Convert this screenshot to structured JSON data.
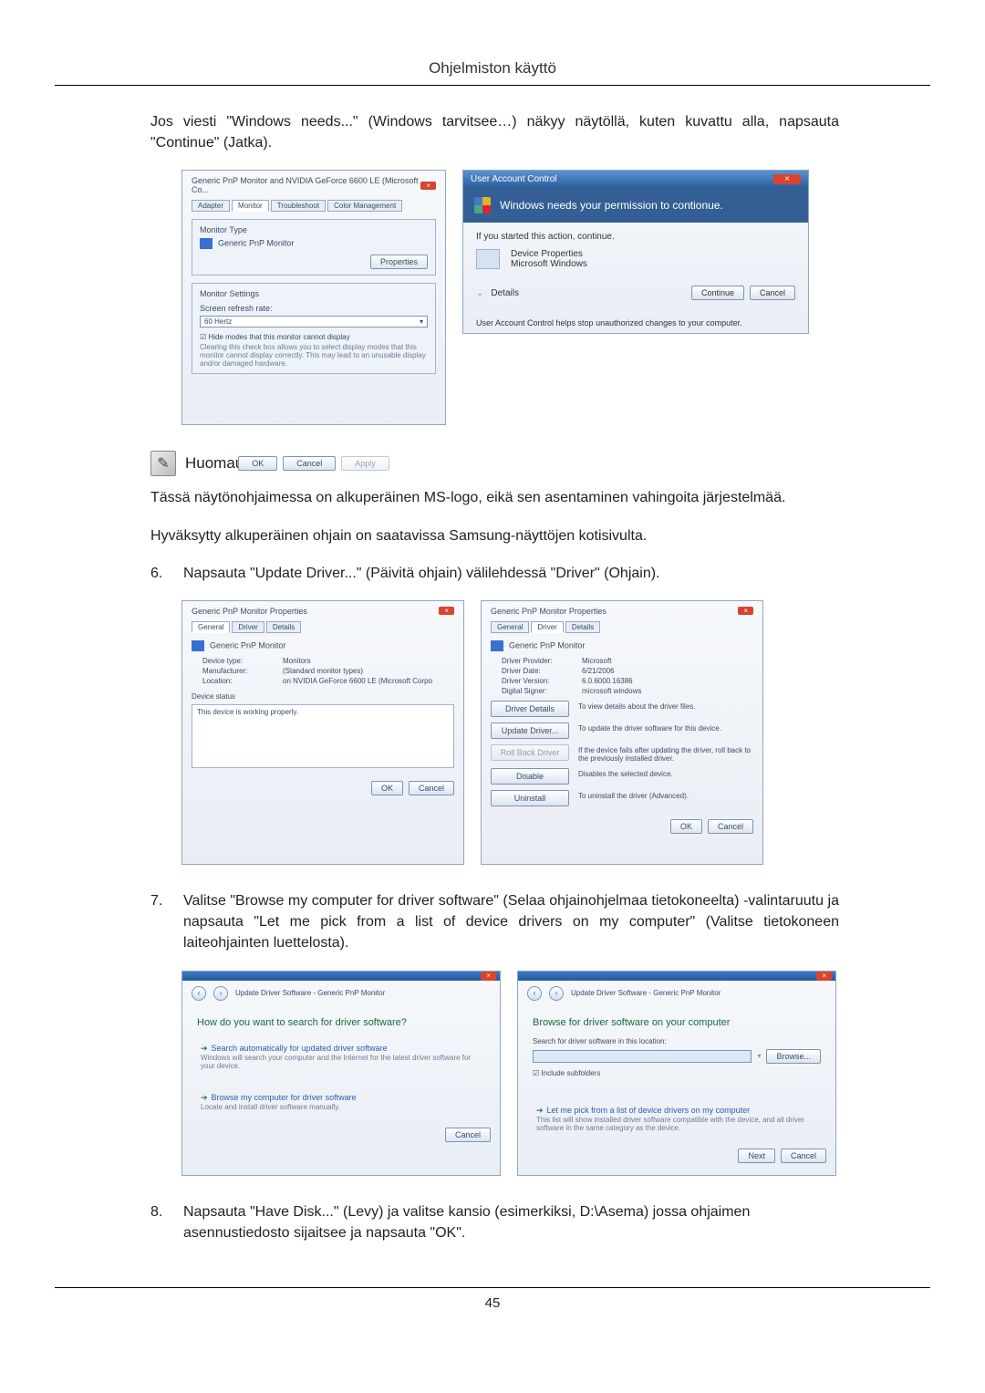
{
  "header": {
    "title": "Ohjelmiston käyttö"
  },
  "intro": "Jos viesti \"Windows needs...\" (Windows tarvitsee…) näkyy näytöllä, kuten kuvattu alla, napsauta \"Continue\" (Jatka).",
  "shot1": {
    "title": "Generic PnP Monitor and NVIDIA GeForce 6600 LE (Microsoft Co...",
    "tabs": {
      "adapter": "Adapter",
      "monitor": "Monitor",
      "troubleshoot": "Troubleshoot",
      "colormgmt": "Color Management"
    },
    "monitor_type_label": "Monitor Type",
    "monitor_name": "Generic PnP Monitor",
    "properties_btn": "Properties",
    "settings_label": "Monitor Settings",
    "refresh_label": "Screen refresh rate:",
    "refresh_value": "60 Hertz",
    "hide_modes": "Hide modes that this monitor cannot display",
    "hide_modes_desc": "Clearing this check box allows you to select display modes that this monitor cannot display correctly. This may lead to an unusable display and/or damaged hardware.",
    "ok": "OK",
    "cancel": "Cancel",
    "apply": "Apply"
  },
  "uac": {
    "title": "User Account Control",
    "banner": "Windows needs your permission to contionue.",
    "line1": "If you started this action, continue.",
    "prog": "Device Properties",
    "pub": "Microsoft Windows",
    "details": "Details",
    "continue": "Continue",
    "cancel": "Cancel",
    "foot": "User Account Control helps stop unauthorized changes to your computer."
  },
  "note": {
    "label": "Huomautus"
  },
  "note_p1": "Tässä näytönohjaimessa on alkuperäinen MS-logo, eikä sen asentaminen vahingoita järjestelmää.",
  "note_p2": "Hyväksytty alkuperäinen ohjain on saatavissa Samsung-näyttöjen kotisivulta.",
  "step6": {
    "num": "6.",
    "text": "Napsauta \"Update Driver...\" (Päivitä ohjain) välilehdessä \"Driver\" (Ohjain)."
  },
  "prop_general": {
    "title": "Generic PnP Monitor Properties",
    "tabs": {
      "general": "General",
      "driver": "Driver",
      "details": "Details"
    },
    "name": "Generic PnP Monitor",
    "devtype_k": "Device type:",
    "devtype_v": "Monitors",
    "manu_k": "Manufacturer:",
    "manu_v": "(Standard monitor types)",
    "loc_k": "Location:",
    "loc_v": "on NVIDIA GeForce 6600 LE (Microsoft Corpo",
    "status_label": "Device status",
    "status_text": "This device is working properly.",
    "ok": "OK",
    "cancel": "Cancel"
  },
  "prop_driver": {
    "title": "Generic PnP Monitor Properties",
    "name": "Generic PnP Monitor",
    "prov_k": "Driver Provider:",
    "prov_v": "Microsoft",
    "date_k": "Driver Date:",
    "date_v": "6/21/2006",
    "ver_k": "Driver Version:",
    "ver_v": "6.0.6000.16386",
    "sign_k": "Digital Signer:",
    "sign_v": "microsoft windows",
    "b1": "Driver Details",
    "d1": "To view details about the driver files.",
    "b2": "Update Driver...",
    "d2": "To update the driver software for this device.",
    "b3": "Roll Back Driver",
    "d3": "If the device fails after updating the driver, roll back to the previously installed driver.",
    "b4": "Disable",
    "d4": "Disables the selected device.",
    "b5": "Uninstall",
    "d5": "To uninstall the driver (Advanced).",
    "ok": "OK",
    "cancel": "Cancel"
  },
  "step7": {
    "num": "7.",
    "text": "Valitse \"Browse my computer for driver software\" (Selaa ohjainohjelmaa tietokoneelta) -valintaruutu ja napsauta \"Let me pick from a list of device drivers on my computer\" (Valitse tietokoneen laiteohjainten luettelosta)."
  },
  "wiz1": {
    "crumb": "Update Driver Software - Generic PnP Monitor",
    "q": "How do you want to search for driver software?",
    "o1t": "Search automatically for updated driver software",
    "o1d": "Windows will search your computer and the Internet for the latest driver software for your device.",
    "o2t": "Browse my computer for driver software",
    "o2d": "Locate and install driver software manually.",
    "cancel": "Cancel"
  },
  "wiz2": {
    "crumb": "Update Driver Software - Generic PnP Monitor",
    "q": "Browse for driver software on your computer",
    "loc_label": "Search for driver software in this location:",
    "browse": "Browse...",
    "include": "Include subfolders",
    "pick_t": "Let me pick from a list of device drivers on my computer",
    "pick_d": "This list will show installed driver software compatible with the device, and all driver software in the same category as the device.",
    "next": "Next",
    "cancel": "Cancel"
  },
  "step8": {
    "num": "8.",
    "text": "Napsauta \"Have Disk...\" (Levy) ja valitse kansio (esimerkiksi, D:\\Asema) jossa ohjaimen asennustiedosto sijaitsee ja napsauta \"OK\"."
  },
  "page_number": "45"
}
